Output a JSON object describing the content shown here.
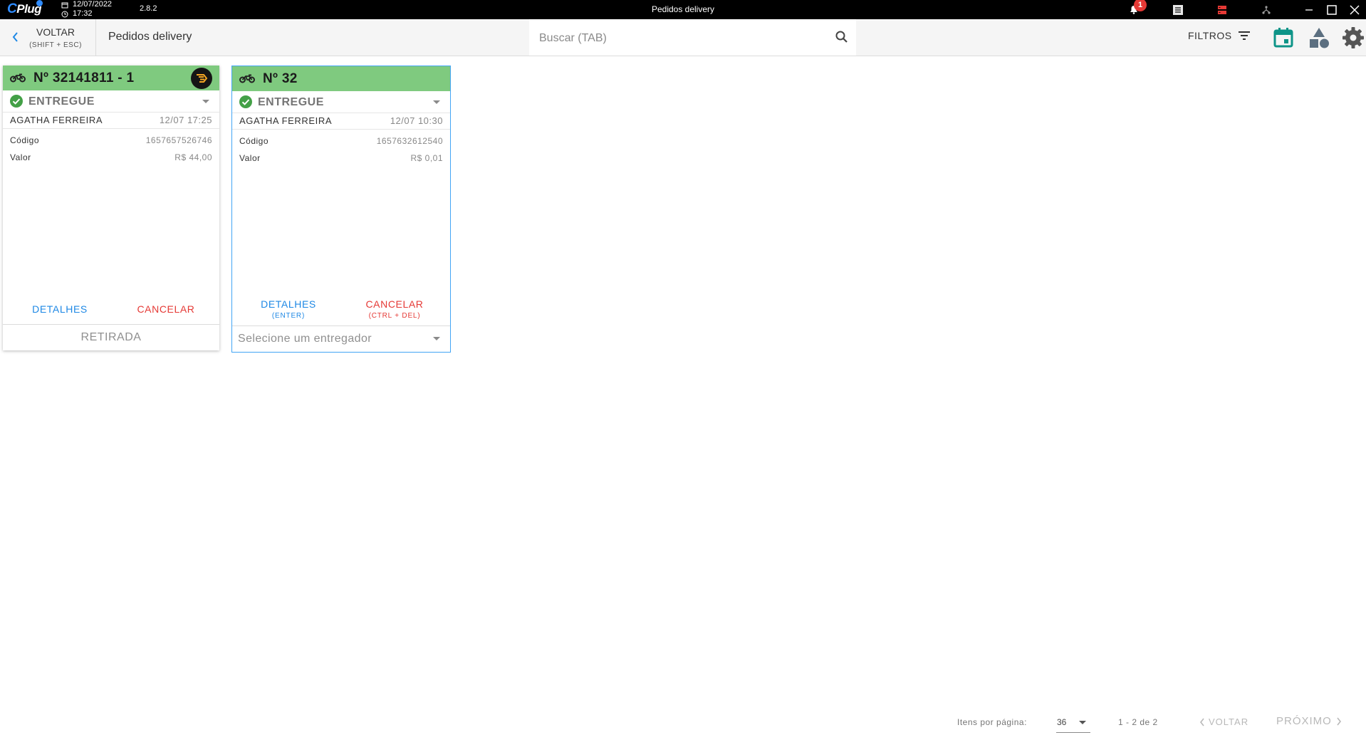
{
  "titlebar": {
    "logo_text": "Plug",
    "logo_c": "C",
    "date": "12/07/2022",
    "time": "17:32",
    "version": "2.8.2",
    "window_title": "Pedidos delivery",
    "notification_count": "1"
  },
  "toolbar": {
    "back_label": "VOLTAR",
    "back_hint": "(SHIFT + ESC)",
    "page_title": "Pedidos delivery",
    "search_placeholder": "Buscar (TAB)",
    "search_value": "",
    "filters_label": "FILTROS"
  },
  "orders": [
    {
      "number": "Nº 32141811 - 1",
      "status": "ENTREGUE",
      "customer": "AGATHA FERREIRA",
      "datetime": "12/07 17:25",
      "code_label": "Código",
      "code": "1657657526746",
      "value_label": "Valor",
      "value": "R$ 44,00",
      "details_label": "DETALHES",
      "cancel_label": "CANCELAR",
      "footer": "RETIRADA"
    },
    {
      "number": "Nº 32",
      "status": "ENTREGUE",
      "customer": "AGATHA FERREIRA",
      "datetime": "12/07 10:30",
      "code_label": "Código",
      "code": "1657632612540",
      "value_label": "Valor",
      "value": "R$ 0,01",
      "details_label": "DETALHES",
      "details_hint": "(ENTER)",
      "cancel_label": "CANCELAR",
      "cancel_hint": "(CTRL + DEL)",
      "courier_placeholder": "Selecione um entregador"
    }
  ],
  "pagination": {
    "items_per_page_label": "Itens por página:",
    "items_per_page": "36",
    "range": "1 - 2 de 2",
    "prev_label": "VOLTAR",
    "next_label": "PRÓXIMO"
  },
  "colors": {
    "card_header": "#7fca7f",
    "accent_blue": "#1e88e5",
    "accent_red": "#e53935",
    "teal_icon": "#0d9488",
    "status_check": "#43a047"
  }
}
